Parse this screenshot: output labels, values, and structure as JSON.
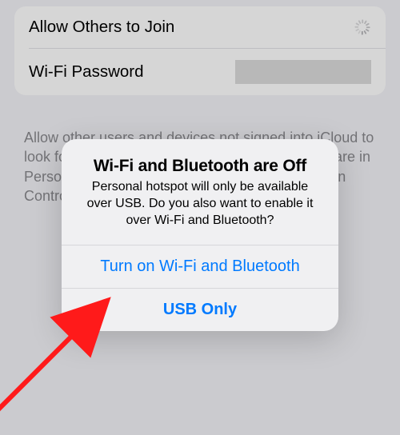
{
  "settings": {
    "allow_label": "Allow Others to Join",
    "password_label": "Wi-Fi Password",
    "password_value_masked": "",
    "help_text": "Allow other users and devices not signed into iCloud to look for your shared network \"iPhone\" when you are in Personal Hotspot settings or when you turn it on in Control Center."
  },
  "alert": {
    "title": "Wi-Fi and Bluetooth are Off",
    "message": "Personal hotspot will only be available over USB. Do you also want to enable it over Wi-Fi and Bluetooth?",
    "primary_label": "Turn on Wi-Fi and Bluetooth",
    "secondary_label": "USB Only"
  },
  "annotation": {
    "arrow_color": "#ff1a1a"
  }
}
